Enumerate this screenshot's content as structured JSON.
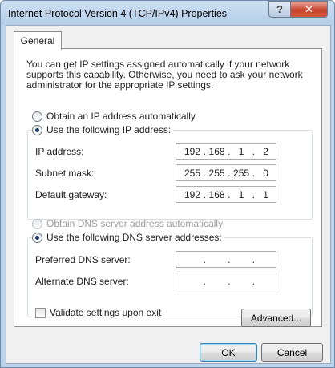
{
  "window": {
    "title": "Internet Protocol Version 4 (TCP/IPv4) Properties",
    "help_label": "?",
    "close_label": "✕"
  },
  "tabs": [
    {
      "label": "General",
      "selected": true
    }
  ],
  "intro_text": "You can get IP settings assigned automatically if your network supports this capability. Otherwise, you need to ask your network administrator for the appropriate IP settings.",
  "ip_section": {
    "auto_label": "Obtain an IP address automatically",
    "manual_label": "Use the following IP address:",
    "selected": "manual",
    "fields": [
      {
        "label": "IP address:",
        "octets": [
          "192",
          "168",
          "1",
          "2"
        ]
      },
      {
        "label": "Subnet mask:",
        "octets": [
          "255",
          "255",
          "255",
          "0"
        ]
      },
      {
        "label": "Default gateway:",
        "octets": [
          "192",
          "168",
          "1",
          "1"
        ]
      }
    ]
  },
  "dns_section": {
    "auto_label": "Obtain DNS server address automatically",
    "manual_label": "Use the following DNS server addresses:",
    "selected": "manual",
    "fields": [
      {
        "label": "Preferred DNS server:",
        "octets": [
          "",
          "",
          "",
          ""
        ]
      },
      {
        "label": "Alternate DNS server:",
        "octets": [
          "",
          "",
          "",
          ""
        ]
      }
    ]
  },
  "validate_label": "Validate settings upon exit",
  "validate_checked": false,
  "buttons": {
    "advanced": "Advanced...",
    "ok": "OK",
    "cancel": "Cancel"
  }
}
